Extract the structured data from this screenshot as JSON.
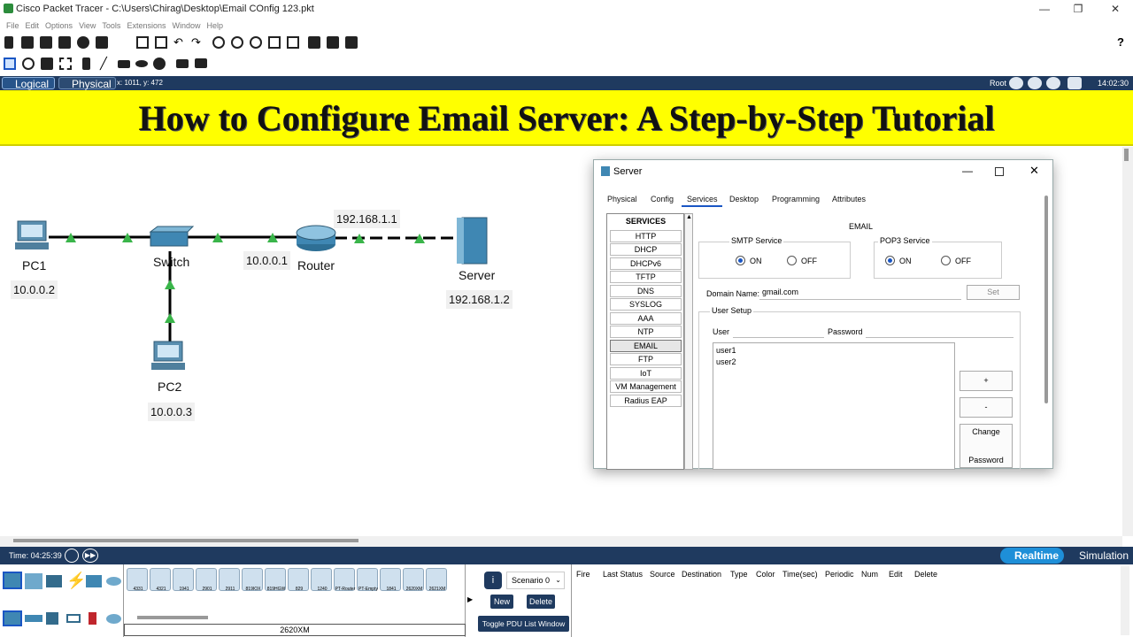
{
  "window": {
    "title": "Cisco Packet Tracer - C:\\Users\\Chirag\\Desktop\\Email COnfig 123.pkt"
  },
  "menu": [
    "File",
    "Edit",
    "Options",
    "View",
    "Tools",
    "Extensions",
    "Window",
    "Help"
  ],
  "tabs": {
    "logical": "Logical",
    "physical": "Physical",
    "coords": "x: 1011, y: 472",
    "root": "Root",
    "clock": "14:02:30"
  },
  "banner": {
    "text": "How to Configure Email Server: A Step-by-Step Tutorial"
  },
  "topology": {
    "pc1": {
      "name": "PC1",
      "ip": "10.0.0.2"
    },
    "pc2": {
      "name": "PC2",
      "ip": "10.0.0.3"
    },
    "switch": {
      "name": "Switch"
    },
    "router": {
      "name": "Router",
      "ip_left": "10.0.0.1",
      "ip_right": "192.168.1.1"
    },
    "server": {
      "name": "Server",
      "ip": "192.168.1.2"
    }
  },
  "dialog": {
    "title": "Server",
    "tabs": [
      "Physical",
      "Config",
      "Services",
      "Desktop",
      "Programming",
      "Attributes"
    ],
    "active_tab": "Services",
    "services_header": "SERVICES",
    "services": [
      "HTTP",
      "DHCP",
      "DHCPv6",
      "TFTP",
      "DNS",
      "SYSLOG",
      "AAA",
      "NTP",
      "EMAIL",
      "FTP",
      "IoT",
      "VM Management",
      "Radius EAP"
    ],
    "selected_service": "EMAIL",
    "panel_title": "EMAIL",
    "smtp": {
      "label": "SMTP Service",
      "on": "ON",
      "off": "OFF"
    },
    "pop3": {
      "label": "POP3 Service",
      "on": "ON",
      "off": "OFF"
    },
    "domain": {
      "label": "Domain Name:",
      "value": "gmail.com",
      "set": "Set"
    },
    "user_setup": {
      "label": "User Setup",
      "user": "User",
      "password": "Password",
      "users": [
        "user1",
        "user2"
      ],
      "add": "+",
      "remove": "-",
      "change1": "Change",
      "change2": "Password"
    }
  },
  "status": {
    "time": "Time: 04:25:39",
    "realtime": "Realtime",
    "simulation": "Simulation"
  },
  "bottom": {
    "devices": [
      "4331",
      "4321",
      "1941",
      "2901",
      "2911",
      "819IOX",
      "819HGW",
      "829",
      "1240",
      "PT-Router",
      "PT-Empty",
      "1841",
      "2620XM",
      "2621XM"
    ],
    "selected_device": "2620XM",
    "scenario": "Scenario 0",
    "new": "New",
    "delete": "Delete",
    "toggle": "Toggle PDU List Window",
    "columns": [
      "Fire",
      "Last Status",
      "Source",
      "Destination",
      "Type",
      "Color",
      "Time(sec)",
      "Periodic",
      "Num",
      "Edit",
      "Delete"
    ]
  },
  "colors": {
    "banner": "#ffff00",
    "bar": "#1f3a5f",
    "link_triangle": "#3ab54a"
  }
}
